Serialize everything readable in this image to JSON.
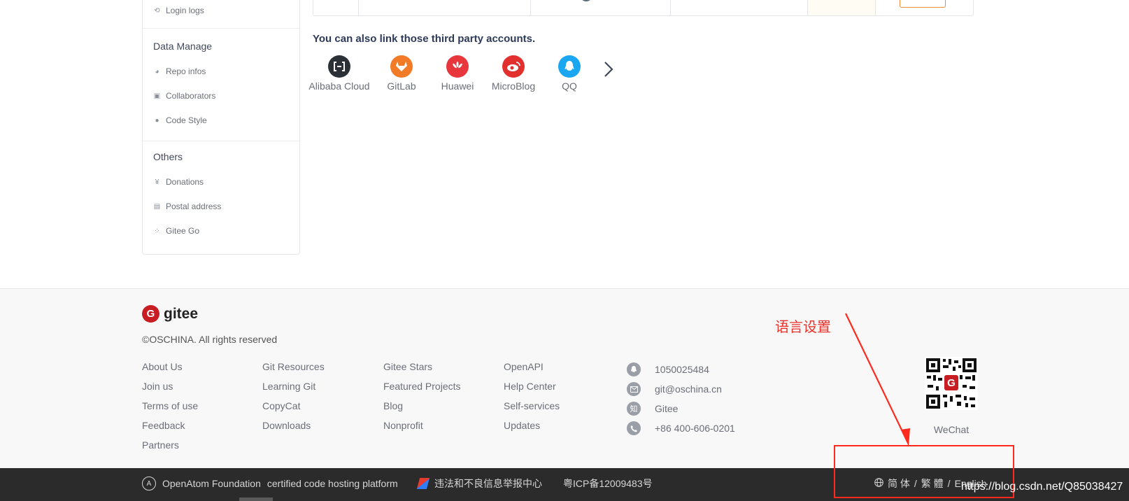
{
  "sidebar": {
    "top_items": [
      {
        "label": "Login logs",
        "icon": "history-icon"
      }
    ],
    "sections": [
      {
        "title": "Data Manage",
        "items": [
          {
            "label": "Repo infos",
            "icon": "pie-chart-icon"
          },
          {
            "label": "Collaborators",
            "icon": "person-badge-icon"
          },
          {
            "label": "Code Style",
            "icon": "palette-icon"
          }
        ]
      },
      {
        "title": "Others",
        "items": [
          {
            "label": "Donations",
            "icon": "yen-icon"
          },
          {
            "label": "Postal address",
            "icon": "address-card-icon"
          },
          {
            "label": "Gitee Go",
            "icon": "pipeline-icon"
          }
        ]
      }
    ]
  },
  "third_party": {
    "title": "You can also link those third party accounts.",
    "accounts": [
      {
        "label": "Alibaba Cloud",
        "icon": "alibaba-cloud-icon",
        "color": "#2b2f36"
      },
      {
        "label": "GitLab",
        "icon": "gitlab-icon",
        "color": "#f27b28"
      },
      {
        "label": "Huawei",
        "icon": "huawei-icon",
        "color": "#e8363d"
      },
      {
        "label": "MicroBlog",
        "icon": "weibo-icon",
        "color": "#e2302f"
      },
      {
        "label": "QQ",
        "icon": "qq-icon",
        "color": "#1aa6f1"
      }
    ],
    "next_icon": "chevron-right-icon"
  },
  "footer": {
    "brand": "gitee",
    "copyright": "©OSCHINA. All rights reserved",
    "columns": [
      [
        "About Us",
        "Join us",
        "Terms of use",
        "Feedback",
        "Partners"
      ],
      [
        "Git Resources",
        "Learning Git",
        "CopyCat",
        "Downloads"
      ],
      [
        "Gitee Stars",
        "Featured Projects",
        "Blog",
        "Nonprofit"
      ],
      [
        "OpenAPI",
        "Help Center",
        "Self-services",
        "Updates"
      ]
    ],
    "contacts": [
      {
        "icon": "qq-icon",
        "text": "1050025484"
      },
      {
        "icon": "mail-icon",
        "text": "git@oschina.cn"
      },
      {
        "icon": "zhihu-icon",
        "text": "Gitee",
        "glyph": "知"
      },
      {
        "icon": "phone-icon",
        "text": "+86 400-606-0201"
      }
    ],
    "wechat_label": "WeChat"
  },
  "annotation": {
    "text": "语言设置",
    "color": "#ff2a1d"
  },
  "bottom_bar": {
    "openatom": "OpenAtom Foundation",
    "certified": "certified code hosting platform",
    "report": "违法和不良信息举报中心",
    "icp": "粤ICP备12009483号",
    "languages": [
      "简 体",
      "繁 體",
      "English"
    ],
    "separator": "/"
  },
  "watermark": "https://blog.csdn.net/Q85038427"
}
